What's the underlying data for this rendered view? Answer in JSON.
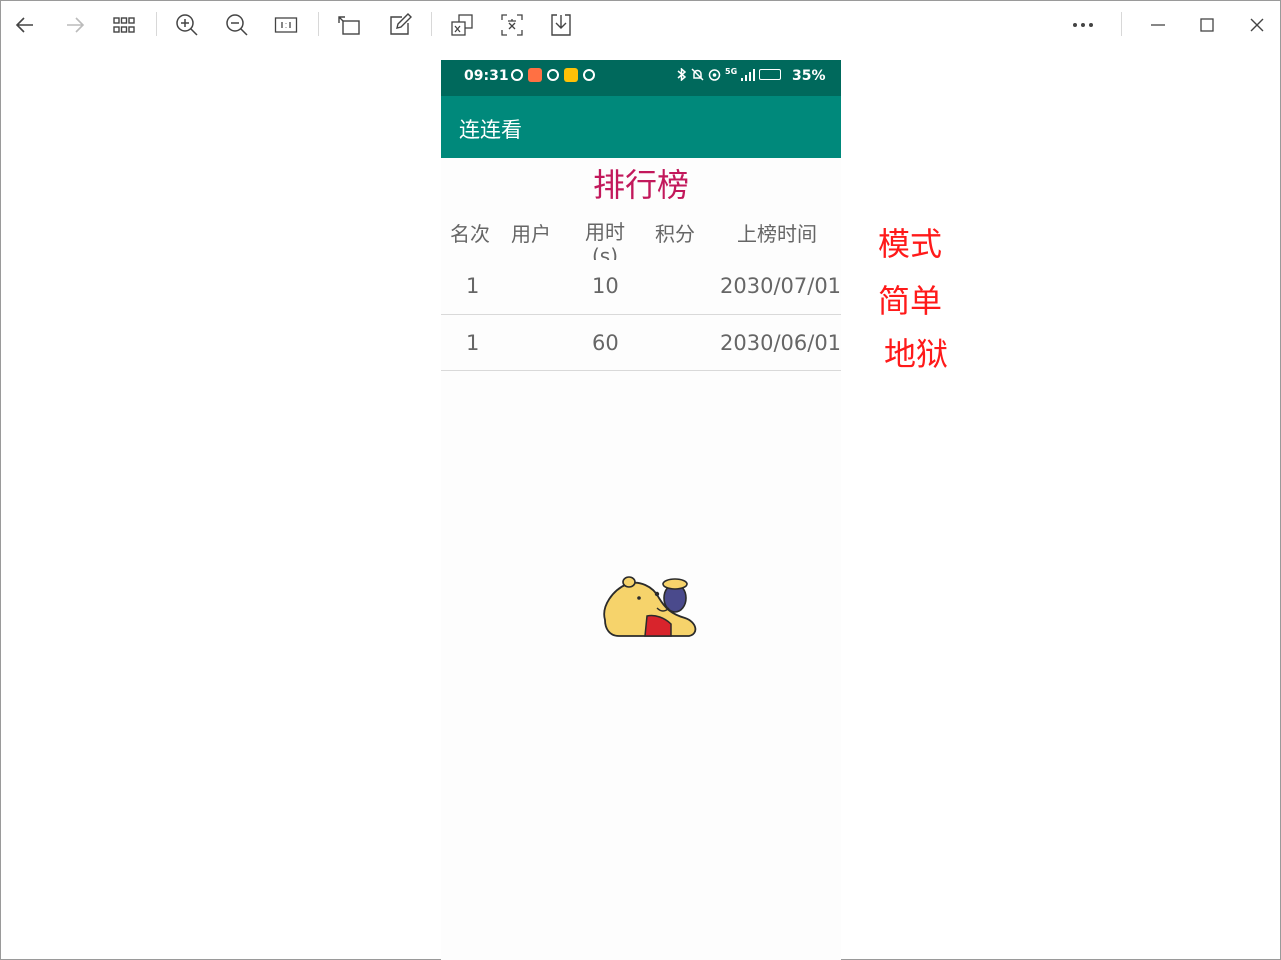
{
  "phone": {
    "status": {
      "time": "09:31",
      "network": "5G",
      "battery": "35%"
    },
    "appbar_title": "连连看",
    "rank_title": "排行榜",
    "columns": [
      "名次",
      "用户",
      "用时(s)",
      "积分",
      "上榜时间"
    ],
    "rows": [
      {
        "rank": "1",
        "user": "",
        "time": "10",
        "score": "",
        "date": "2030/07/01"
      },
      {
        "rank": "1",
        "user": "",
        "time": "60",
        "score": "",
        "date": "2030/06/01"
      }
    ]
  },
  "annotations": {
    "mode_label": "模式",
    "mode_easy": "简单",
    "mode_hell": "地狱"
  },
  "colors": {
    "status_bar": "#00695c",
    "app_bar": "#00897b",
    "rank_title": "#c2185b",
    "annotation": "#ff1a1a"
  }
}
